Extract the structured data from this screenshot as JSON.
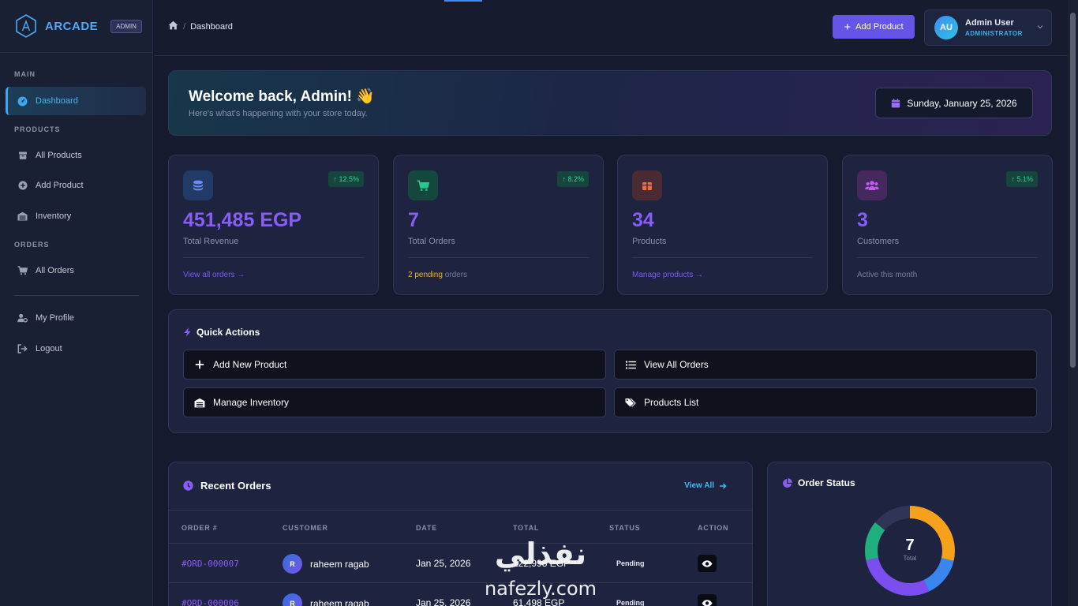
{
  "brand": {
    "name": "ARCADE",
    "badge": "ADMIN"
  },
  "sidebar": {
    "sections": [
      {
        "label": "MAIN"
      },
      {
        "label": "PRODUCTS"
      },
      {
        "label": "ORDERS"
      }
    ],
    "items": [
      {
        "label": "Dashboard",
        "icon": "dashboard-icon",
        "active": true
      },
      {
        "label": "All Products",
        "icon": "box-icon"
      },
      {
        "label": "Add Product",
        "icon": "plus-circle-icon"
      },
      {
        "label": "Inventory",
        "icon": "warehouse-icon"
      },
      {
        "label": "All Orders",
        "icon": "cart-icon"
      },
      {
        "label": "My Profile",
        "icon": "user-gear-icon"
      },
      {
        "label": "Logout",
        "icon": "logout-icon"
      }
    ]
  },
  "header": {
    "breadcrumb": {
      "current": "Dashboard"
    },
    "add_button": "Add Product",
    "user": {
      "initials": "AU",
      "name": "Admin User",
      "role": "ADMINISTRATOR"
    }
  },
  "welcome": {
    "title": "Welcome back, Admin! 👋",
    "subtitle": "Here's what's happening with your store today.",
    "date": "Sunday, January 25, 2026"
  },
  "stats": [
    {
      "value": "451,485 EGP",
      "label": "Total Revenue",
      "badge": "↑ 12.5%",
      "foot": "View all orders →",
      "icon": "coins-icon",
      "accent": "#3a6df0"
    },
    {
      "value": "7",
      "label": "Total Orders",
      "badge": "↑ 8.2%",
      "foot_warn": "2 pending",
      "foot_rest": " orders",
      "icon": "cart-icon",
      "accent": "#19b27b"
    },
    {
      "value": "34",
      "label": "Products",
      "foot": "Manage products →",
      "icon": "gift-box-icon",
      "accent": "#f06a4a"
    },
    {
      "value": "3",
      "label": "Customers",
      "badge": "↑ 5.1%",
      "foot": "Active this month",
      "icon": "users-icon",
      "accent": "#b04ae8"
    }
  ],
  "quick_actions": {
    "title": "Quick Actions",
    "buttons": [
      {
        "label": "Add New Product",
        "icon": "plus-icon"
      },
      {
        "label": "View All Orders",
        "icon": "list-icon"
      },
      {
        "label": "Manage Inventory",
        "icon": "warehouse-icon"
      },
      {
        "label": "Products List",
        "icon": "tags-icon"
      }
    ]
  },
  "recent_orders": {
    "title": "Recent Orders",
    "view_all": "View All",
    "columns": [
      "ORDER #",
      "CUSTOMER",
      "DATE",
      "TOTAL",
      "STATUS",
      "ACTION"
    ],
    "rows": [
      {
        "id": "#ORD-000007",
        "initial": "R",
        "customer": "raheem ragab",
        "date": "Jan 25, 2026",
        "total": "122,998 EGP",
        "status": "Pending"
      },
      {
        "id": "#ORD-000006",
        "initial": "R",
        "customer": "raheem ragab",
        "date": "Jan 25, 2026",
        "total": "61,498 EGP",
        "status": "Pending"
      }
    ]
  },
  "order_status": {
    "title": "Order Status",
    "total": "7",
    "total_label": "Total",
    "segment_colors": [
      "#f5a11c",
      "#3a86f0",
      "#7c4ef0",
      "#1fb07e",
      "#2e3556"
    ]
  },
  "watermark": {
    "arabic": "نفذلي",
    "latin": "nafezly.com"
  },
  "colors": {
    "accent": "#6653e8",
    "brand": "#4fa9f2",
    "success": "#2fd49b",
    "warning": "#f0b232"
  }
}
